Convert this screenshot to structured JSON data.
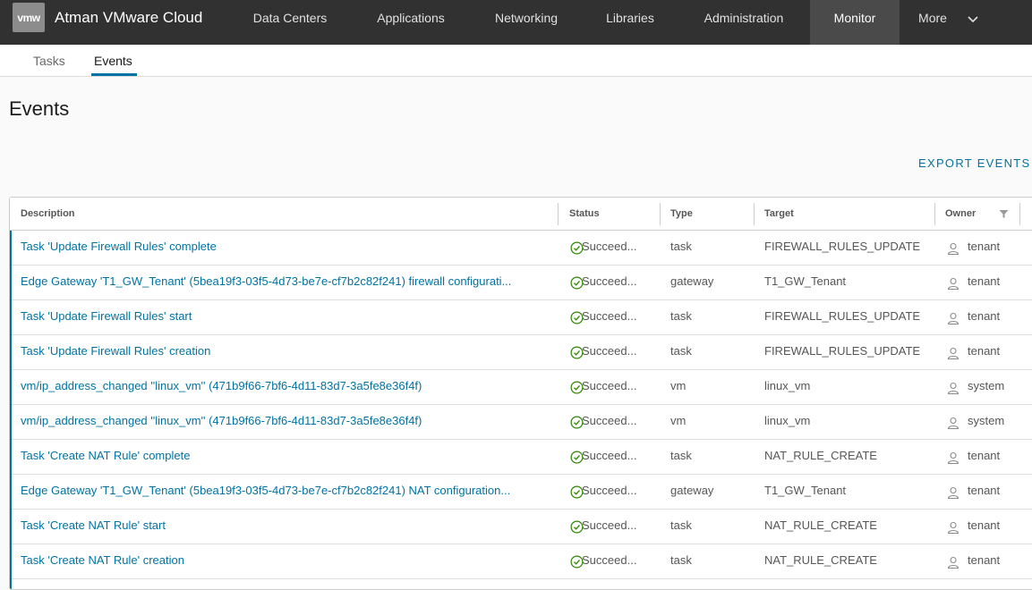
{
  "header": {
    "logo_text": "vmw",
    "brand": "Atman VMware Cloud",
    "nav": [
      {
        "label": "Data Centers"
      },
      {
        "label": "Applications"
      },
      {
        "label": "Networking"
      },
      {
        "label": "Libraries"
      },
      {
        "label": "Administration"
      },
      {
        "label": "Monitor",
        "active": true
      },
      {
        "label": "More"
      }
    ]
  },
  "subtabs": [
    {
      "label": "Tasks"
    },
    {
      "label": "Events",
      "active": true
    }
  ],
  "page_title": "Events",
  "export_label": "EXPORT EVENTS",
  "grid": {
    "columns": [
      "Description",
      "Status",
      "Type",
      "Target",
      "Owner"
    ],
    "rows": [
      {
        "description": "Task 'Update Firewall Rules' complete",
        "status": "Succeed...",
        "type": "task",
        "target": "FIREWALL_RULES_UPDATE",
        "owner": "tenant"
      },
      {
        "description": "Edge Gateway 'T1_GW_Tenant' (5bea19f3-03f5-4d73-be7e-cf7b2c82f241) firewall configurati...",
        "status": "Succeed...",
        "type": "gateway",
        "target": "T1_GW_Tenant",
        "owner": "tenant"
      },
      {
        "description": "Task 'Update Firewall Rules' start",
        "status": "Succeed...",
        "type": "task",
        "target": "FIREWALL_RULES_UPDATE",
        "owner": "tenant"
      },
      {
        "description": "Task 'Update Firewall Rules' creation",
        "status": "Succeed...",
        "type": "task",
        "target": "FIREWALL_RULES_UPDATE",
        "owner": "tenant"
      },
      {
        "description": "vm/ip_address_changed ''linux_vm'' (471b9f66-7bf6-4d11-83d7-3a5fe8e36f4f)",
        "status": "Succeed...",
        "type": "vm",
        "target": "linux_vm",
        "owner": "system"
      },
      {
        "description": "vm/ip_address_changed ''linux_vm'' (471b9f66-7bf6-4d11-83d7-3a5fe8e36f4f)",
        "status": "Succeed...",
        "type": "vm",
        "target": "linux_vm",
        "owner": "system"
      },
      {
        "description": "Task 'Create NAT Rule' complete",
        "status": "Succeed...",
        "type": "task",
        "target": "NAT_RULE_CREATE",
        "owner": "tenant"
      },
      {
        "description": "Edge Gateway 'T1_GW_Tenant' (5bea19f3-03f5-4d73-be7e-cf7b2c82f241) NAT configuration...",
        "status": "Succeed...",
        "type": "gateway",
        "target": "T1_GW_Tenant",
        "owner": "tenant"
      },
      {
        "description": "Task 'Create NAT Rule' start",
        "status": "Succeed...",
        "type": "task",
        "target": "NAT_RULE_CREATE",
        "owner": "tenant"
      },
      {
        "description": "Task 'Create NAT Rule' creation",
        "status": "Succeed...",
        "type": "task",
        "target": "NAT_RULE_CREATE",
        "owner": "tenant"
      }
    ]
  },
  "colors": {
    "header_bg": "#313131",
    "accent": "#0072a3",
    "success": "#2e8500"
  },
  "icons": {
    "status": "check-circle-icon",
    "owner": "user-icon",
    "filter": "filter-icon",
    "more": "chevron-down-icon"
  }
}
